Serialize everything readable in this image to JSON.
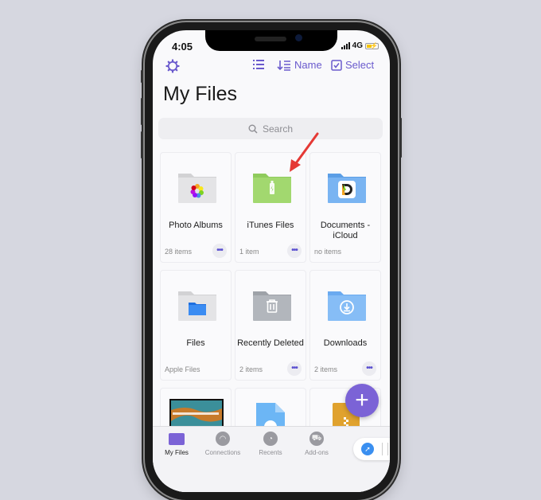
{
  "status_bar": {
    "time": "4:05",
    "network": "4G"
  },
  "toolbar": {
    "settings_icon": "gear-icon",
    "list_view_icon": "list-icon",
    "sort_label": "Name",
    "select_label": "Select"
  },
  "page_title": "My Files",
  "search": {
    "placeholder": "Search"
  },
  "items": [
    {
      "name": "Photo Albums",
      "sub": "28 items",
      "icon": "photos-folder-icon",
      "has_more": true
    },
    {
      "name": "iTunes Files",
      "sub": "1 item",
      "icon": "itunes-folder-icon",
      "has_more": true
    },
    {
      "name": "Documents - iCloud",
      "sub": "no items",
      "icon": "documents-folder-icon",
      "has_more": false
    },
    {
      "name": "Files",
      "sub": "Apple Files",
      "icon": "files-folder-icon",
      "has_more": false
    },
    {
      "name": "Recently Deleted",
      "sub": "2 items",
      "icon": "trash-folder-icon",
      "has_more": true
    },
    {
      "name": "Downloads",
      "sub": "2 items",
      "icon": "downloads-folder-icon",
      "has_more": true
    }
  ],
  "more_label": "•••",
  "fab_label": "+",
  "tabs": [
    {
      "label": "My Files",
      "active": true
    },
    {
      "label": "Connections",
      "active": false
    },
    {
      "label": "Recents",
      "active": false
    },
    {
      "label": "Add-ons",
      "active": false
    }
  ],
  "colors": {
    "accent": "#6a5acd",
    "fab": "#7b63d6",
    "annotation_arrow": "#e53935"
  }
}
